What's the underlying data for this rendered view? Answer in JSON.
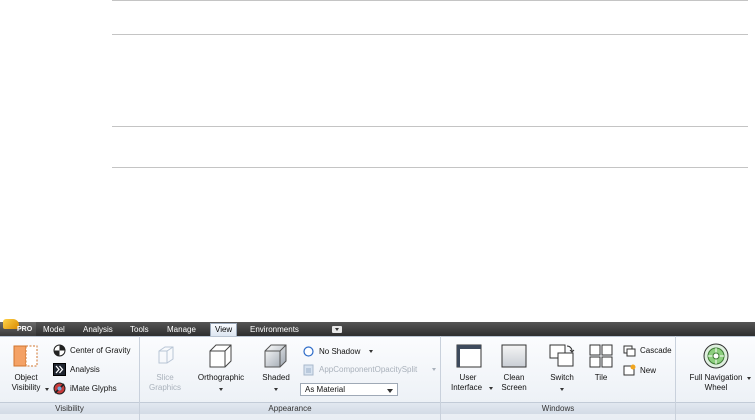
{
  "ribbon": {
    "app_badge": "PRO",
    "tabs": [
      {
        "label": "Model"
      },
      {
        "label": "Analysis"
      },
      {
        "label": "Tools"
      },
      {
        "label": "Manage"
      },
      {
        "label": "View"
      },
      {
        "label": "Environments"
      }
    ],
    "active_tab": "View",
    "panels": {
      "visibility": {
        "label": "Visibility",
        "object_visibility": "Object Visibility",
        "object_visibility_line1": "Object",
        "object_visibility_line2": "Visibility",
        "center_of_gravity": "Center of Gravity",
        "analysis": "Analysis",
        "imate_glyphs": "iMate Glyphs"
      },
      "appearance": {
        "label": "Appearance",
        "slice_graphics_line1": "Slice",
        "slice_graphics_line2": "Graphics",
        "orthographic": "Orthographic",
        "shaded": "Shaded",
        "no_shadow": "No Shadow",
        "opacity_split": "AppComponentOpacitySplit",
        "material_select": "As Material"
      },
      "windows": {
        "label": "Windows",
        "user_interface_line1": "User",
        "user_interface_line2": "Interface",
        "clean_screen_line1": "Clean",
        "clean_screen_line2": "Screen",
        "switch": "Switch",
        "tile": "Tile",
        "cascade": "Cascade",
        "new": "New"
      },
      "navigate": {
        "full_navigation_line1": "Full Navigation",
        "full_navigation_line2": "Wheel"
      }
    }
  }
}
